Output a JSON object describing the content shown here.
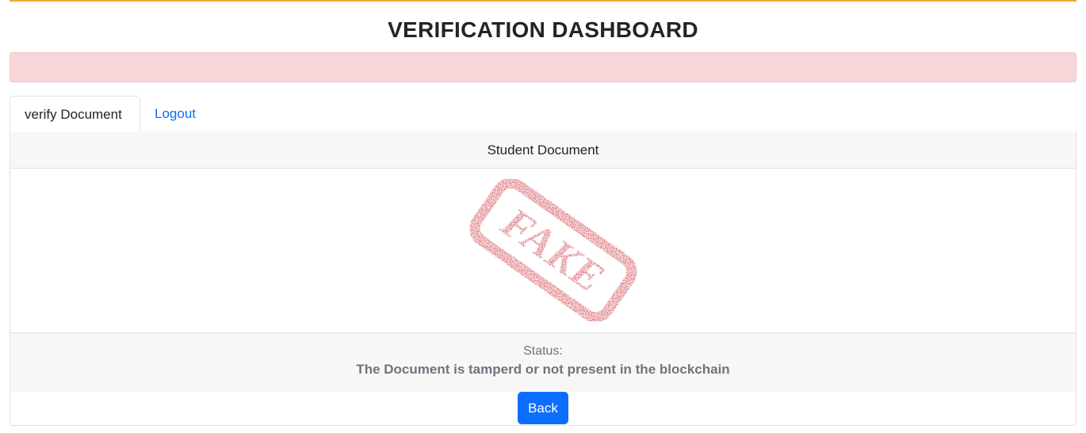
{
  "header": {
    "title": "VERIFICATION DASHBOARD",
    "accent_color": "#f0a838"
  },
  "alert": {
    "text": "",
    "color": "#f8d7da"
  },
  "tabs": [
    {
      "label": "verify Document",
      "active": true
    },
    {
      "label": "Logout",
      "active": false
    }
  ],
  "card": {
    "header": "Student Document",
    "stamp": {
      "text": "FAKE",
      "icon": "fake-stamp-image",
      "color": "#c00010"
    },
    "status_label": "Status:",
    "status_text": "The Document is tamperd or not present in the blockchain",
    "back_label": "Back",
    "button_color": "#0d6efd"
  }
}
